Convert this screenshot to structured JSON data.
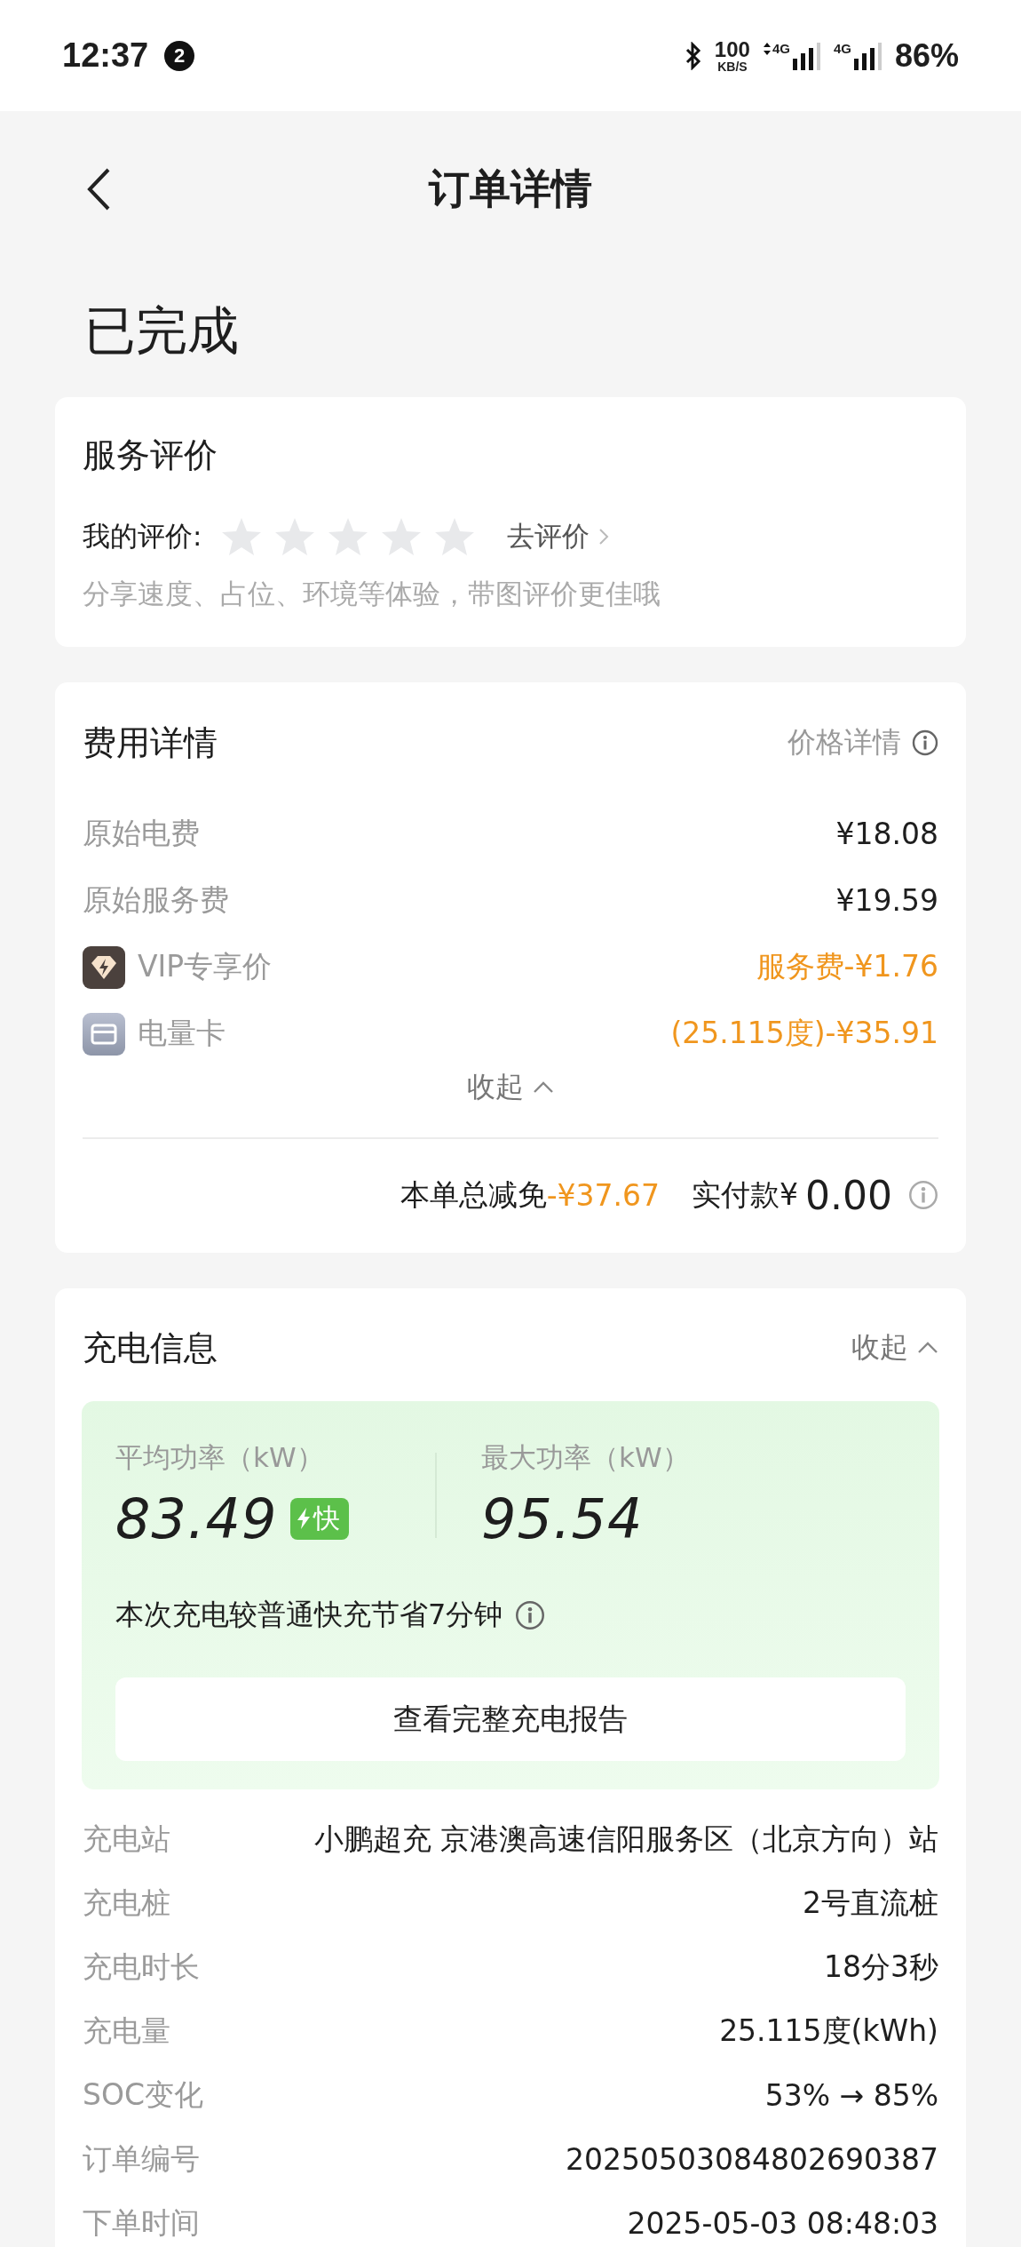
{
  "status_bar": {
    "time": "12:37",
    "notification_count": "2",
    "network_speed": "100",
    "network_speed_unit": "KB/S",
    "signal_1_label": "4G",
    "signal_2_label": "4G",
    "battery": "86%"
  },
  "header": {
    "title": "订单详情"
  },
  "order_status": "已完成",
  "rating": {
    "title": "服务评价",
    "label": "我的评价:",
    "stars": 0,
    "action": "去评价",
    "hint": "分享速度、占位、环境等体验，带图评价更佳哦"
  },
  "fees": {
    "title": "费用详情",
    "link": "价格详情",
    "items": [
      {
        "kind": "plain",
        "label": "原始电费",
        "value": "¥18.08"
      },
      {
        "kind": "plain",
        "label": "原始服务费",
        "value": "¥19.59"
      },
      {
        "kind": "vip",
        "label": "VIP专享价",
        "value": "服务费-¥1.76"
      },
      {
        "kind": "card",
        "label": "电量卡",
        "value": "(25.115度)-¥35.91"
      }
    ],
    "collapse": "收起",
    "total_label": "本单总减免",
    "total_discount": "-¥37.67",
    "paid_label": "实付款¥",
    "paid": "0.00"
  },
  "charging": {
    "title": "充电信息",
    "collapse": "收起",
    "avg_label": "平均功率（kW）",
    "avg_value": "83.49",
    "fast_badge": "快",
    "max_label": "最大功率（kW）",
    "max_value": "95.54",
    "note": "本次充电较普通快充节省7分钟",
    "report_button": "查看完整充电报告",
    "details": [
      {
        "label": "充电站",
        "value": "小鹏超充 京港澳高速信阳服务区（北京方向）站"
      },
      {
        "label": "充电桩",
        "value": "2号直流桩"
      },
      {
        "label": "充电时长",
        "value": "18分3秒"
      },
      {
        "label": "充电量",
        "value": "25.115度(kWh)"
      },
      {
        "label": "SOC变化",
        "value": "53% → 85%"
      },
      {
        "label": "订单编号",
        "value": "20250503084802690387"
      },
      {
        "label": "下单时间",
        "value": "2025-05-03 08:48:03"
      }
    ]
  }
}
